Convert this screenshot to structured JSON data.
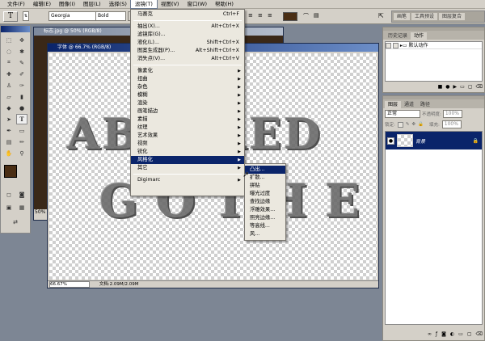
{
  "menubar": {
    "items": [
      {
        "label": "文件(F)"
      },
      {
        "label": "编辑(E)"
      },
      {
        "label": "图像(I)"
      },
      {
        "label": "图层(L)"
      },
      {
        "label": "选择(S)"
      },
      {
        "label": "滤镜(T)"
      },
      {
        "label": "视图(V)"
      },
      {
        "label": "窗口(W)"
      },
      {
        "label": "帮助(H)"
      }
    ]
  },
  "options": {
    "tool_glyph": "T",
    "font_family": "Georgia",
    "font_style": "Bold",
    "color_swatch": "#4a2e14"
  },
  "toolbox": {
    "fg_color": "#4a2e14",
    "bg_color": "#ffffff"
  },
  "back_doc": {
    "title": "标志.jpg @ 50% (RGB/8)",
    "zoom": "50%"
  },
  "front_doc": {
    "title": "字体 @ 66.7% (RGB/8)",
    "line1": "ABERRED",
    "line2": "GOTHE",
    "zoom": "66.67%",
    "status": "文档:2.09M/2.09M"
  },
  "filter_menu": {
    "top": {
      "label": "马赛克",
      "shortcut": "Ctrl+F"
    },
    "group1": [
      {
        "label": "抽出(X)...",
        "shortcut": "Alt+Ctrl+X"
      },
      {
        "label": "滤镜库(G)..."
      },
      {
        "label": "液化(L)...",
        "shortcut": "Shift+Ctrl+X"
      },
      {
        "label": "图案生成器(P)...",
        "shortcut": "Alt+Shift+Ctrl+X"
      },
      {
        "label": "消失点(V)...",
        "shortcut": "Alt+Ctrl+V"
      }
    ],
    "group2": [
      {
        "label": "像素化"
      },
      {
        "label": "扭曲"
      },
      {
        "label": "杂色"
      },
      {
        "label": "模糊"
      },
      {
        "label": "渲染"
      },
      {
        "label": "画笔描边"
      },
      {
        "label": "素描"
      },
      {
        "label": "纹理"
      },
      {
        "label": "艺术效果"
      },
      {
        "label": "视频"
      },
      {
        "label": "锐化"
      },
      {
        "label": "风格化"
      },
      {
        "label": "其它"
      }
    ],
    "bottom": {
      "label": "Digimarc"
    }
  },
  "stylize_submenu": [
    {
      "label": "凸出..."
    },
    {
      "label": "扩散..."
    },
    {
      "label": "拼贴"
    },
    {
      "label": "曝光过度"
    },
    {
      "label": "查找边缘"
    },
    {
      "label": "浮雕效果..."
    },
    {
      "label": "照亮边缘..."
    },
    {
      "label": "等高线..."
    },
    {
      "label": "风..."
    }
  ],
  "panel_top": {
    "dock_tabs": [
      "画笔",
      "工具预设",
      "图层复合"
    ],
    "tabs": [
      "历史记录",
      "动作"
    ],
    "action_item": "默认动作"
  },
  "layers_panel": {
    "tabs": [
      "图层",
      "通道",
      "路径"
    ],
    "blend_mode": "正常",
    "opacity_label": "不透明度:",
    "opacity_value": "100%",
    "lock_label": "锁定:",
    "fill_label": "填充:",
    "fill_value": "100%",
    "layer_name": "背景"
  }
}
